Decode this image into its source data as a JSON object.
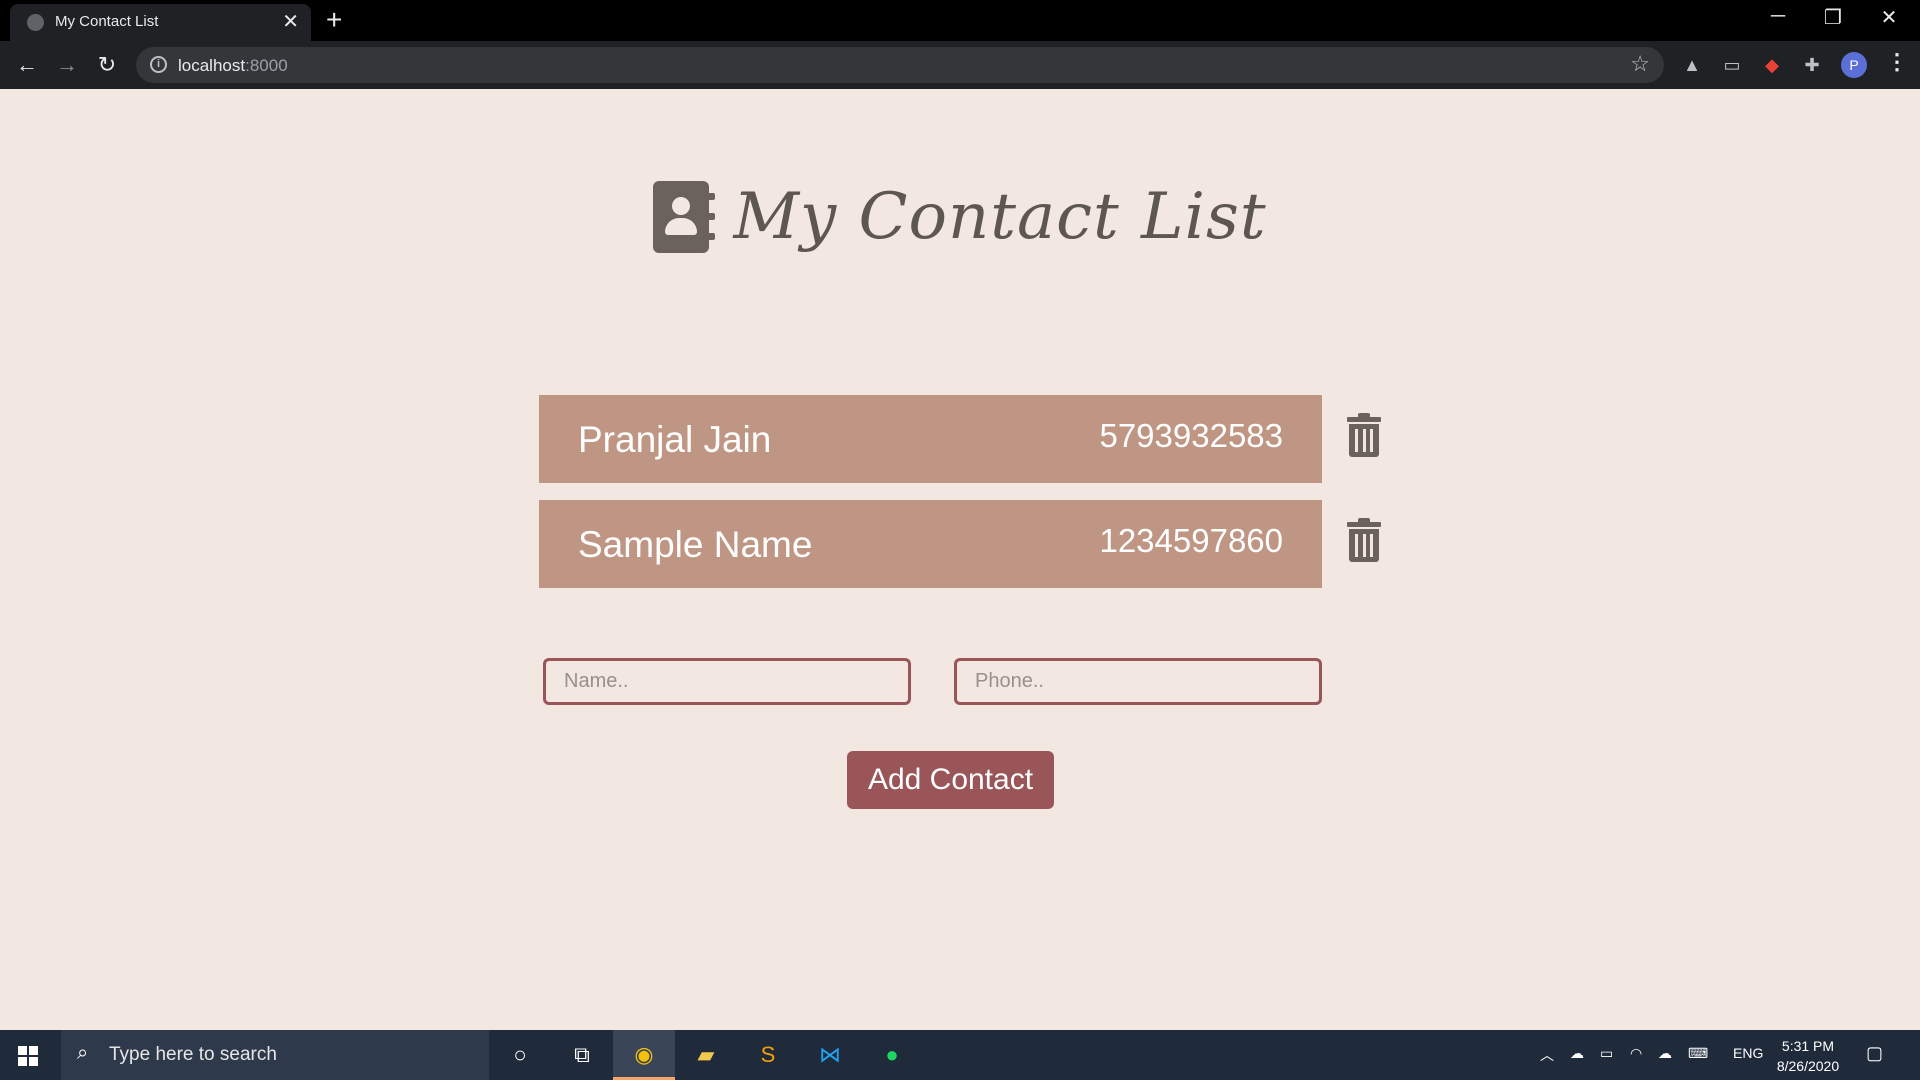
{
  "browser": {
    "tab_title": "My Contact List",
    "tab_close": "✕",
    "new_tab": "+",
    "url_host": "localhost",
    "url_port": ":8000",
    "window_controls": {
      "minimize": "─",
      "restore": "❐",
      "close": "✕"
    },
    "profile_initial": "P"
  },
  "page": {
    "title": "My Contact List"
  },
  "contacts": [
    {
      "name": "Pranjal Jain",
      "phone": "5793932583"
    },
    {
      "name": "Sample Name",
      "phone": "1234597860"
    }
  ],
  "form": {
    "name_placeholder": "Name..",
    "phone_placeholder": "Phone..",
    "submit_label": "Add Contact"
  },
  "taskbar": {
    "search_placeholder": "Type here to search",
    "language": "ENG",
    "time": "5:31 PM",
    "date": "8/26/2020"
  },
  "colors": {
    "page_background": "#f2e7e1",
    "card": "#bf9684",
    "accent": "#9a5559",
    "icon": "#6b625c"
  }
}
